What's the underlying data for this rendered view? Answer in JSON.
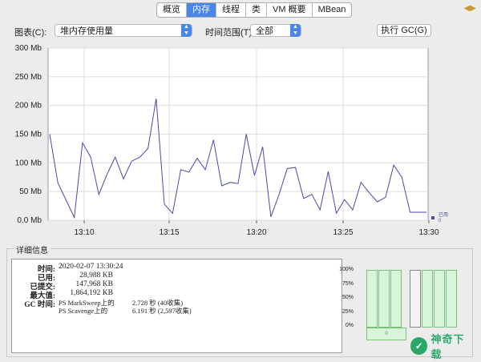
{
  "tabs": [
    "概览",
    "内存",
    "线程",
    "类",
    "VM 概要",
    "MBean"
  ],
  "active_tab": 1,
  "controls": {
    "chart_label": "图表(C):",
    "chart_value": "堆内存使用量",
    "range_label": "时间范围(T):",
    "range_value": "全部",
    "gc_button": "执行 GC(G)"
  },
  "chart_data": {
    "type": "line",
    "yticks": [
      "300 Mb",
      "250 Mb",
      "200 Mb",
      "150 Mb",
      "100 Mb",
      "50 Mb",
      "0.0 Mb"
    ],
    "xticks": [
      "13:10",
      "13:15",
      "13:20",
      "13:25",
      "13:30"
    ],
    "ylim": [
      0,
      300
    ],
    "series_color": "#4a4aa8",
    "values": [
      150,
      65,
      35,
      5,
      135,
      110,
      45,
      80,
      110,
      72,
      103,
      110,
      125,
      212,
      28,
      12,
      88,
      84,
      108,
      88,
      140,
      60,
      66,
      64,
      150,
      78,
      128,
      6,
      45,
      90,
      92,
      38,
      45,
      18,
      85,
      12,
      36,
      18,
      66,
      48,
      32,
      40,
      96,
      75,
      14,
      14,
      14
    ],
    "legend_label": "已用",
    "legend_value": "0"
  },
  "details": {
    "title": "详细信息",
    "rows": [
      {
        "k": "时间:",
        "v": "2020-02-07 13:30:24"
      },
      {
        "k": "已用:",
        "v": "28,988 KB"
      },
      {
        "k": "已提交:",
        "v": "147,968 KB"
      },
      {
        "k": "最大值:",
        "v": "1,864,192 KB"
      }
    ],
    "gc_label": "GC 时间:",
    "gc_rows": [
      {
        "name": "PS MarkSweep上的",
        "value": "2.728 秒 (40收集)"
      },
      {
        "name": "PS Scavenge上的",
        "value": "6.191 秒 (2,597收集)"
      }
    ]
  },
  "pool_bars": {
    "ylabels": [
      "100%",
      "75%",
      "50%",
      "25%",
      "0%"
    ],
    "base_label": "0"
  },
  "watermark": "神奇下载"
}
